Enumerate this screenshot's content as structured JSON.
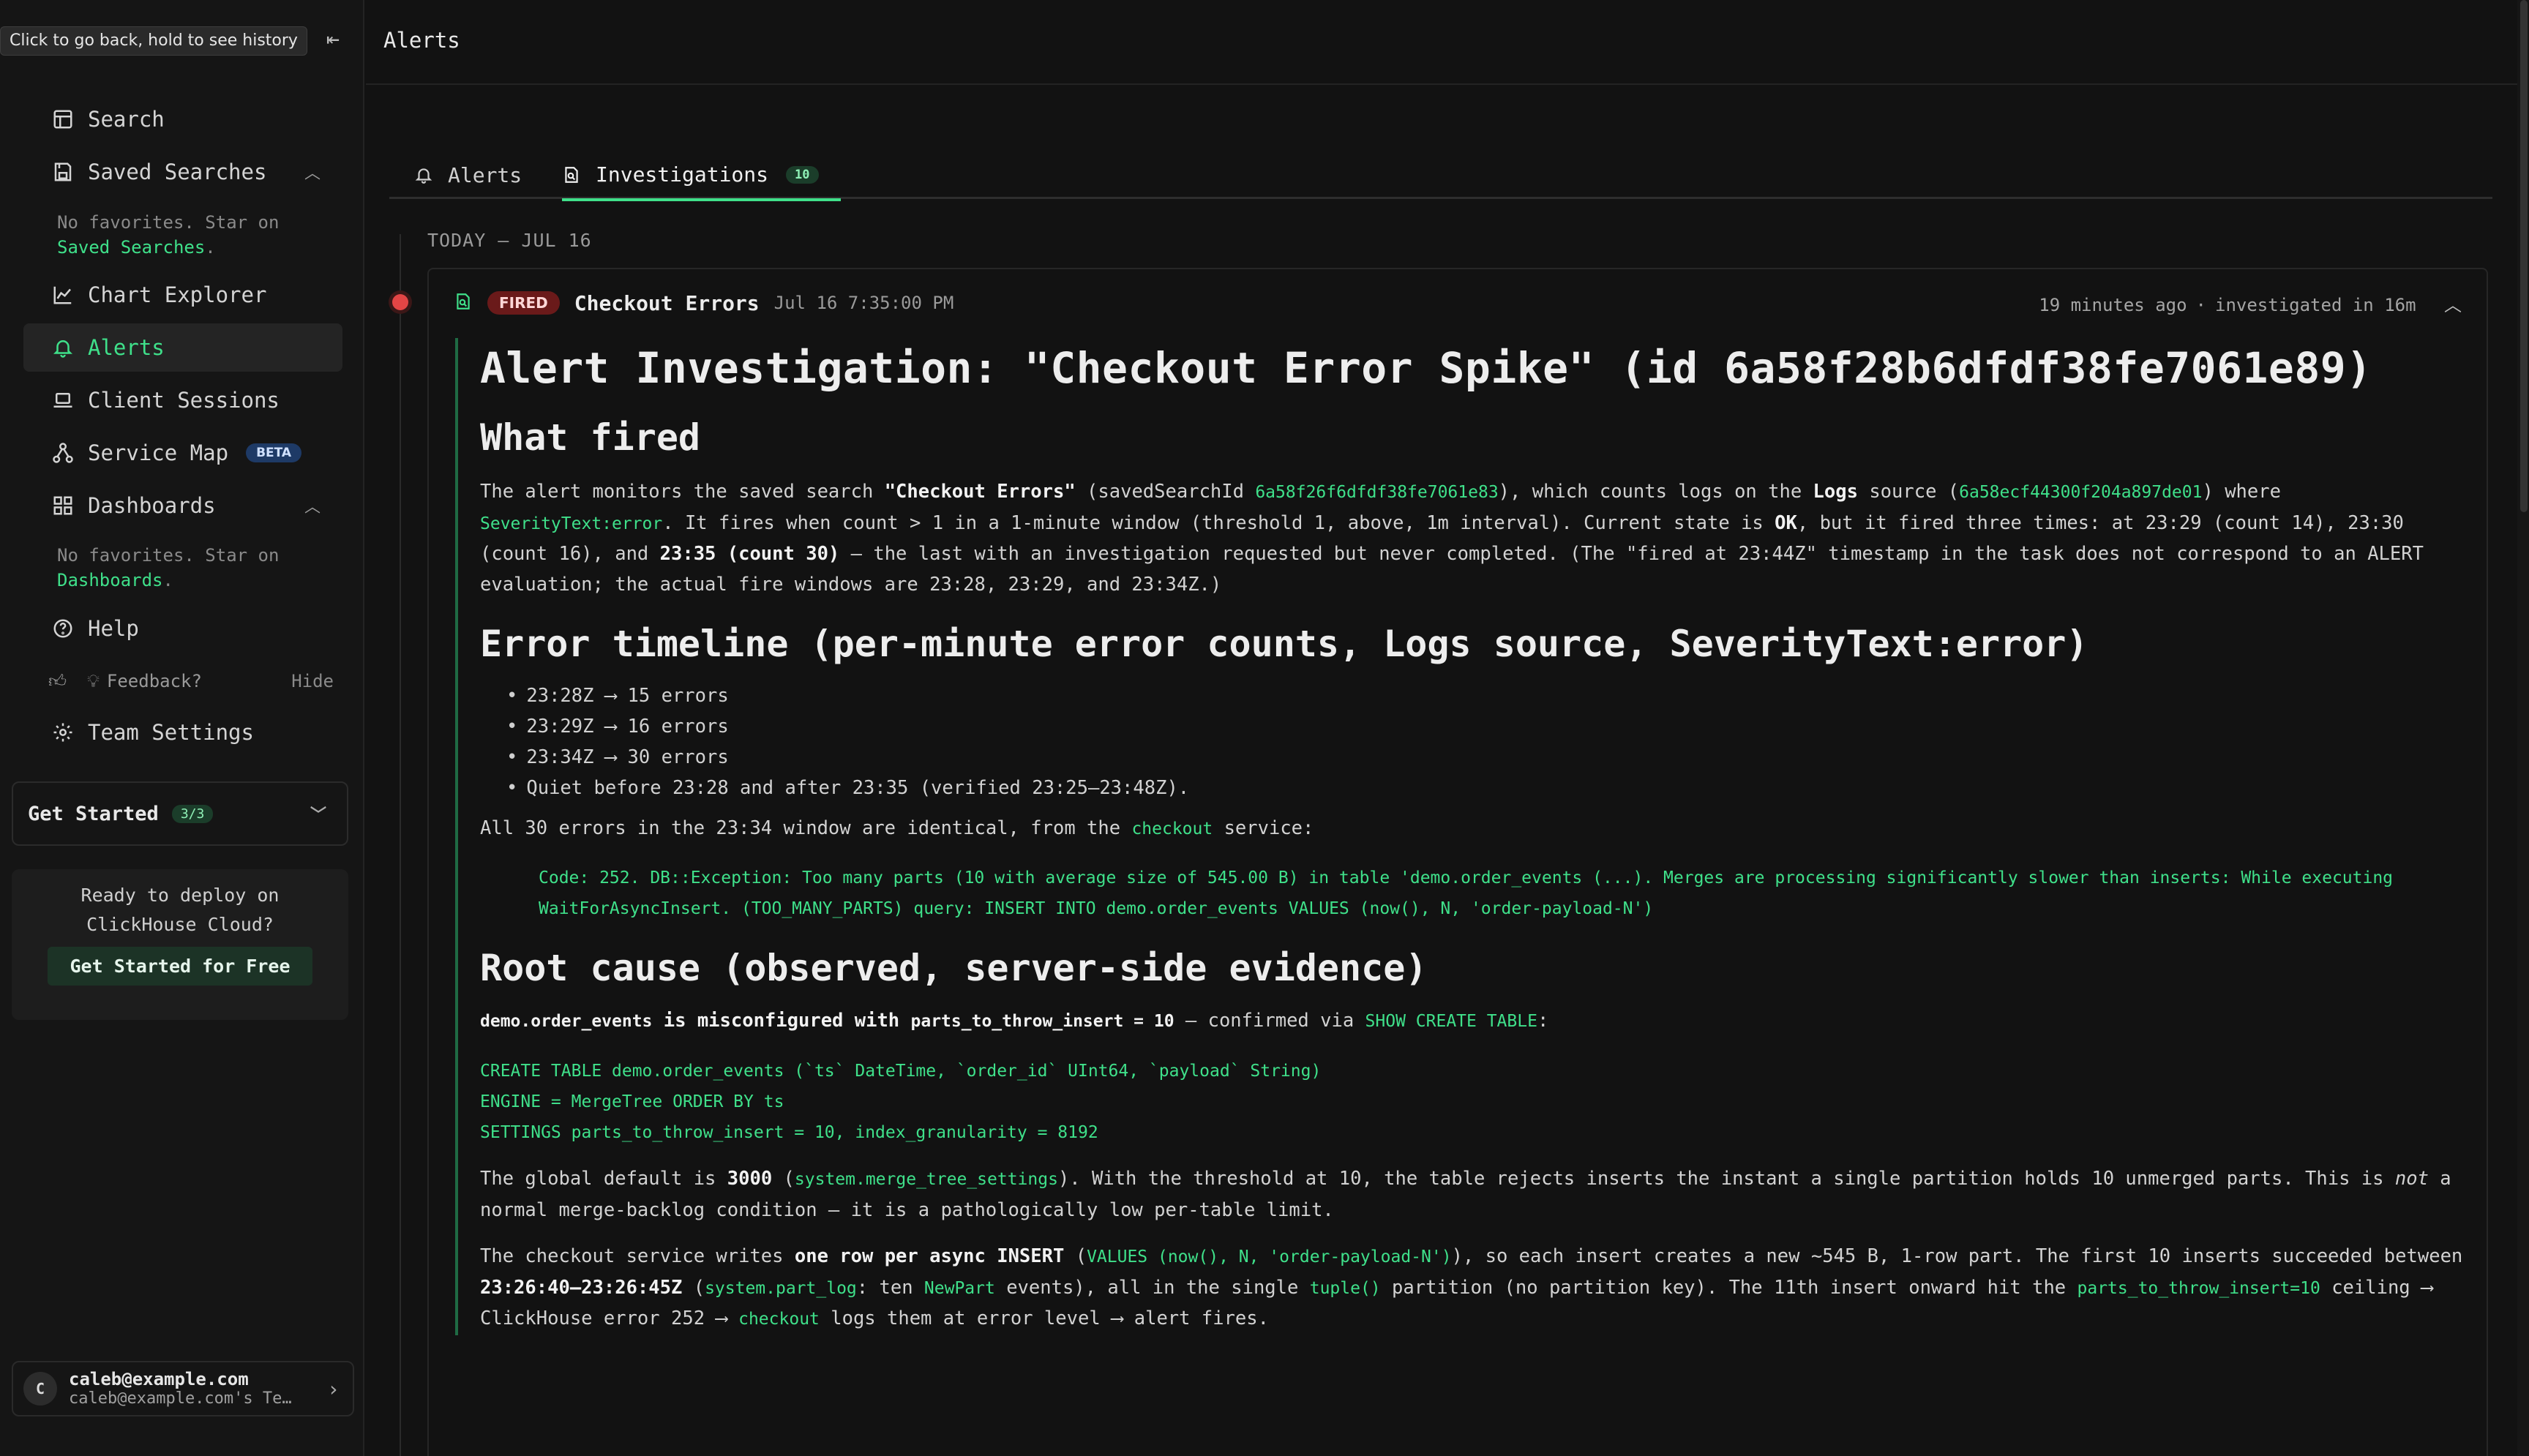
{
  "tooltip": "Click to go back, hold to see history",
  "sidebar": {
    "search": "Search",
    "saved_searches": "Saved Searches",
    "saved_searches_empty_prefix": "No favorites. Star on",
    "saved_searches_empty_link": "Saved Searches",
    "chart_explorer": "Chart Explorer",
    "alerts": "Alerts",
    "client_sessions": "Client Sessions",
    "service_map": "Service Map",
    "service_map_badge": "BETA",
    "dashboards": "Dashboards",
    "dashboards_empty_prefix": "No favorites. Star on",
    "dashboards_empty_link": "Dashboards",
    "help": "Help",
    "feedback": "Feedback?",
    "hide": "Hide",
    "team_settings": "Team Settings",
    "get_started": "Get Started",
    "get_started_badge": "3/3",
    "deploy_text": "Ready to deploy on ClickHouse Cloud?",
    "deploy_button": "Get Started for Free",
    "user_initial": "C",
    "user_email": "caleb@example.com",
    "user_team": "caleb@example.com's Te…"
  },
  "page": {
    "title": "Alerts",
    "tabs": [
      {
        "label": "Alerts"
      },
      {
        "label": "Investigations",
        "badge": "10"
      }
    ],
    "date_group": "TODAY — JUL 16"
  },
  "alert": {
    "status": "FIRED",
    "name": "Checkout Errors",
    "time": "Jul 16 7:35:00 PM",
    "relative": "19 minutes ago",
    "investigated": "investigated in 16m",
    "status_color": "#e34545",
    "accent_color": "#3fe08a"
  },
  "report": {
    "title": "Alert Investigation: \"Checkout Error Spike\" (id 6a58f28b6dfdf38fe7061e89)",
    "what_fired_heading": "What fired",
    "p1": [
      "The alert monitors the saved search ",
      "\"Checkout Errors\"",
      " (savedSearchId ",
      "6a58f26f6dfdf38fe7061e83",
      "), which counts logs on the ",
      "Logs",
      " source (",
      "6a58ecf44300f204a897de01",
      ") where ",
      "SeverityText:error",
      ". It fires when count > 1 in a 1-minute window (threshold 1, above, 1m interval). Current state is ",
      "OK",
      ", but it fired three times: at 23:29 (count 14), 23:30 (count 16), and ",
      "23:35 (count 30)",
      " — the last with an investigation requested but never completed. (The \"fired at 23:44Z\" timestamp in the task does not correspond to an ALERT evaluation; the actual fire windows are 23:28, 23:29, and 23:34Z.)"
    ],
    "timeline_heading": "Error timeline (per-minute error counts, Logs source, SeverityText:error)",
    "timeline_items": [
      "23:28Z ⟶ 15 errors",
      "23:29Z ⟶ 16 errors",
      "23:34Z ⟶ 30 errors",
      "Quiet before 23:28 and after 23:35 (verified 23:25–23:48Z)."
    ],
    "p2": [
      "All 30 errors in the 23:34 window are identical, from the ",
      "checkout",
      " service:"
    ],
    "error_code_lines": [
      "Code: 252. DB::Exception: Too many parts (10 with average size of 545.00 B) in table 'demo.order_events (...). Merges are processing significantly slower than inserts: While executing",
      "WaitForAsyncInsert. (TOO_MANY_PARTS) query: INSERT INTO demo.order_events VALUES (now(), N, 'order-payload-N')"
    ],
    "root_cause_heading": "Root cause (observed, server-side evidence)",
    "p3": [
      "demo.order_events",
      " is misconfigured with ",
      "parts_to_throw_insert = 10",
      " — confirmed via ",
      "SHOW CREATE TABLE",
      ":"
    ],
    "sql_lines": [
      "CREATE TABLE demo.order_events (`ts` DateTime, `order_id` UInt64, `payload` String)",
      "ENGINE = MergeTree ORDER BY ts",
      "SETTINGS parts_to_throw_insert = 10, index_granularity = 8192"
    ],
    "p4": [
      "The global default is ",
      "3000",
      " (",
      "system.merge_tree_settings",
      "). With the threshold at 10, the table rejects inserts the instant a single partition holds 10 unmerged parts. This is ",
      "not",
      " a normal merge-backlog condition — it is a pathologically low per-table limit."
    ],
    "p5": [
      "The checkout service writes ",
      "one row per async INSERT",
      " (",
      "VALUES (now(), N, 'order-payload-N')",
      "), so each insert creates a new ~545 B, 1-row part. The first 10 inserts succeeded between ",
      "23:26:40–23:26:45Z",
      " (",
      "system.part_log",
      ": ten ",
      "NewPart",
      " events), all in the single ",
      "tuple()",
      " partition (no partition key). The 11th insert onward hit the ",
      "parts_to_throw_insert=10",
      " ceiling ⟶ ClickHouse error 252 ⟶ ",
      "checkout",
      " logs them at error level ⟶ alert fires."
    ]
  }
}
